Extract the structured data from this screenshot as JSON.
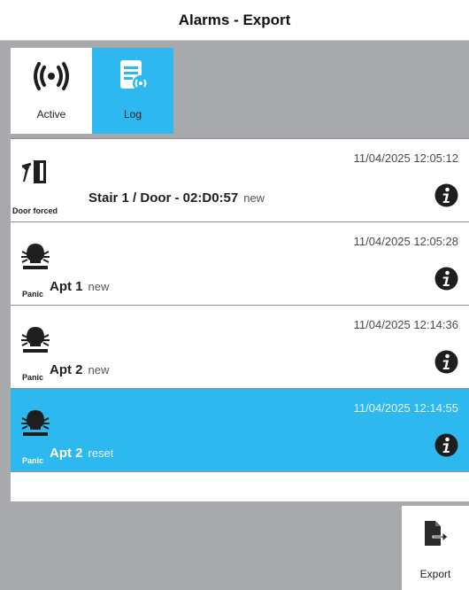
{
  "header": {
    "title": "Alarms - Export"
  },
  "tabs": [
    {
      "label": "Active",
      "icon": "alarm-signal-icon",
      "selected": false
    },
    {
      "label": "Log",
      "icon": "log-document-icon",
      "selected": true
    }
  ],
  "alarms": [
    {
      "type": "Door forced",
      "icon": "door-forced-icon",
      "name": "Stair 1 / Door - 02:D0:57",
      "status": "new",
      "time": "11/04/2025 12:05:12"
    },
    {
      "type": "Panic",
      "icon": "panic-person-icon",
      "name": "Apt 1",
      "status": "new",
      "time": "11/04/2025 12:05:28"
    },
    {
      "type": "Panic",
      "icon": "panic-person-icon",
      "name": "Apt 2",
      "status": "new",
      "time": "11/04/2025 12:14:36"
    },
    {
      "type": "Panic",
      "icon": "panic-person-icon",
      "name": "Apt 2",
      "status": "reset",
      "time": "11/04/2025 12:14:55",
      "selected": true
    }
  ],
  "footer": {
    "export_label": "Export",
    "export_icon": "export-document-icon"
  },
  "colors": {
    "accent": "#2db8f0",
    "background": "#a7a9ac",
    "surface": "#ffffff"
  }
}
